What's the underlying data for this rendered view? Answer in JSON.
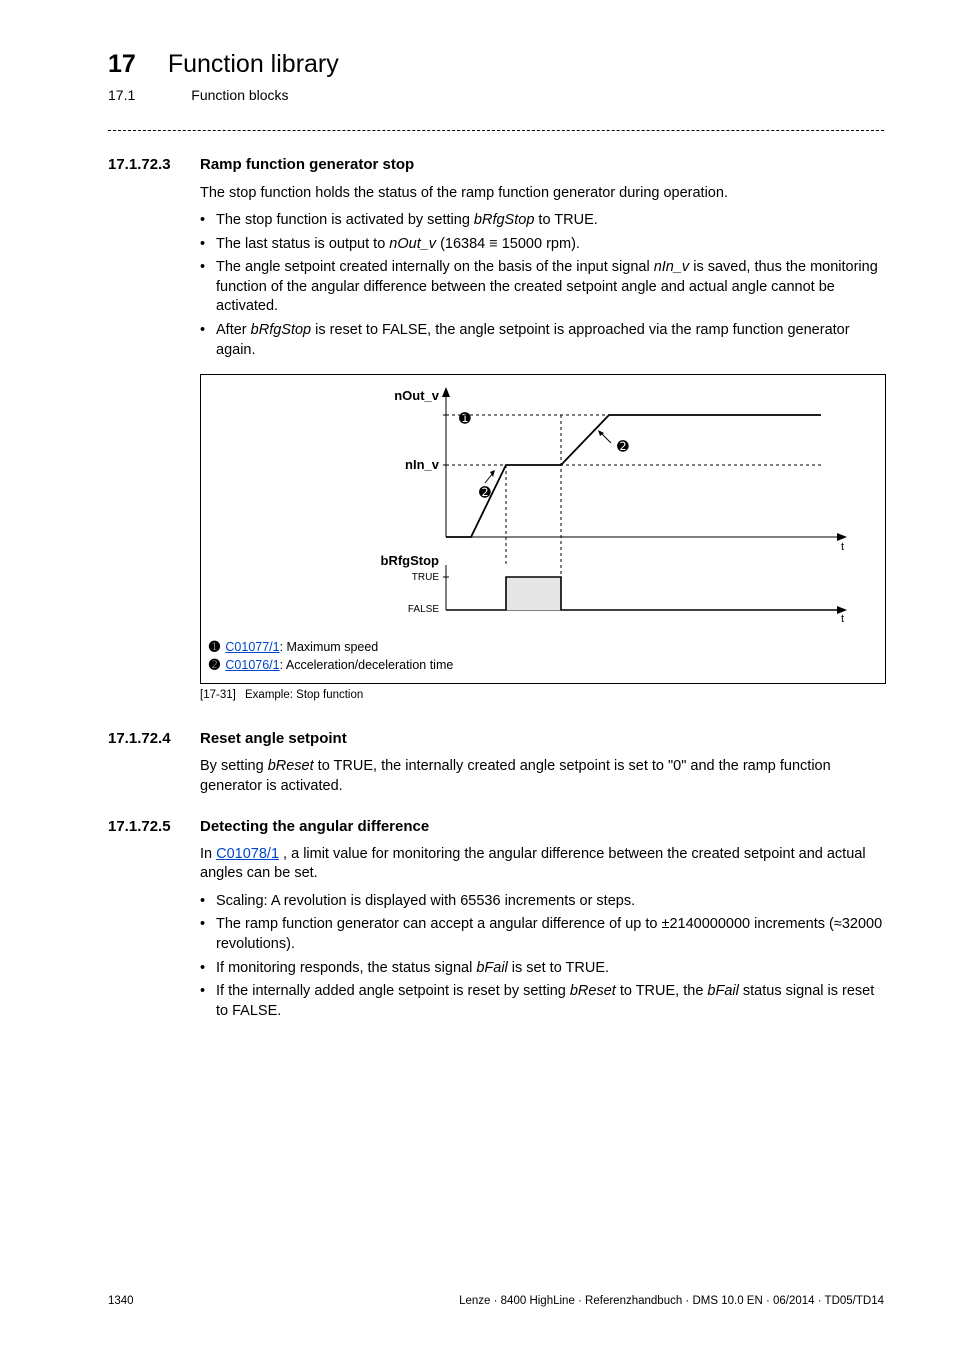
{
  "header": {
    "chapter_num": "17",
    "chapter_title": "Function library",
    "sub_num": "17.1",
    "sub_title": "Function blocks"
  },
  "section1": {
    "num": "17.1.72.3",
    "title": "Ramp function generator stop",
    "intro": "The stop function holds the status of the ramp function generator during operation.",
    "bullets": [
      {
        "pre": "The stop function is activated by setting ",
        "em": "bRfgStop",
        "post": " to TRUE."
      },
      {
        "text": "The last status is output to ",
        "em": "nOut_v",
        "post": " (16384 ≡ 15000 rpm)."
      },
      {
        "pre": "The angle setpoint created internally on the basis of the input signal ",
        "em": "nIn_v",
        "post": " is saved, thus the monitoring function of the angular difference between the created setpoint angle and actual angle cannot be activated."
      },
      {
        "pre": "After ",
        "em": "bRfgStop",
        "post": " is reset to FALSE, the angle setpoint is approached via the ramp function generator again."
      }
    ],
    "legend": {
      "l1_code": "C01077/1",
      "l1_text": ": Maximum speed",
      "l2_code": "C01076/1",
      "l2_text": ": Acceleration/deceleration time"
    },
    "figcap_num": "[17-31]",
    "figcap_text": "Example: Stop function",
    "chart": {
      "labels": {
        "nOut_v": "nOut_v",
        "nIn_v": "nIn_v",
        "bRfgStop": "bRfgStop",
        "true": "TRUE",
        "false": "FALSE",
        "t1": "t",
        "t2": "t"
      }
    }
  },
  "section2": {
    "num": "17.1.72.4",
    "title": "Reset angle setpoint",
    "body_pre": "By setting ",
    "body_em": "bReset",
    "body_post": " to TRUE, the internally created angle setpoint is set to \"0\" and the ramp function generator is activated."
  },
  "section3": {
    "num": "17.1.72.5",
    "title": "Detecting the angular difference",
    "intro_pre": "In ",
    "intro_link": "C01078/1",
    "intro_post": " , a limit value for monitoring the angular difference between the created setpoint and actual angles can be set.",
    "bullets": {
      "b1": "Scaling: A revolution is displayed with 65536 increments or steps.",
      "b2": "The ramp function generator can accept a angular difference of up to ±2140000000 increments (≈32000 revolutions).",
      "b3_pre": "If monitoring responds, the status signal ",
      "b3_em": "bFail",
      "b3_post": " is set to TRUE.",
      "b4_pre": "If the internally added angle setpoint is reset by setting ",
      "b4_em1": "bReset",
      "b4_mid": " to TRUE, the ",
      "b4_em2": "bFail",
      "b4_post": " status signal is reset to FALSE."
    }
  },
  "footer": {
    "page": "1340",
    "right": "Lenze · 8400 HighLine · Referenzhandbuch · DMS 10.0 EN · 06/2014 · TD05/TD14"
  }
}
